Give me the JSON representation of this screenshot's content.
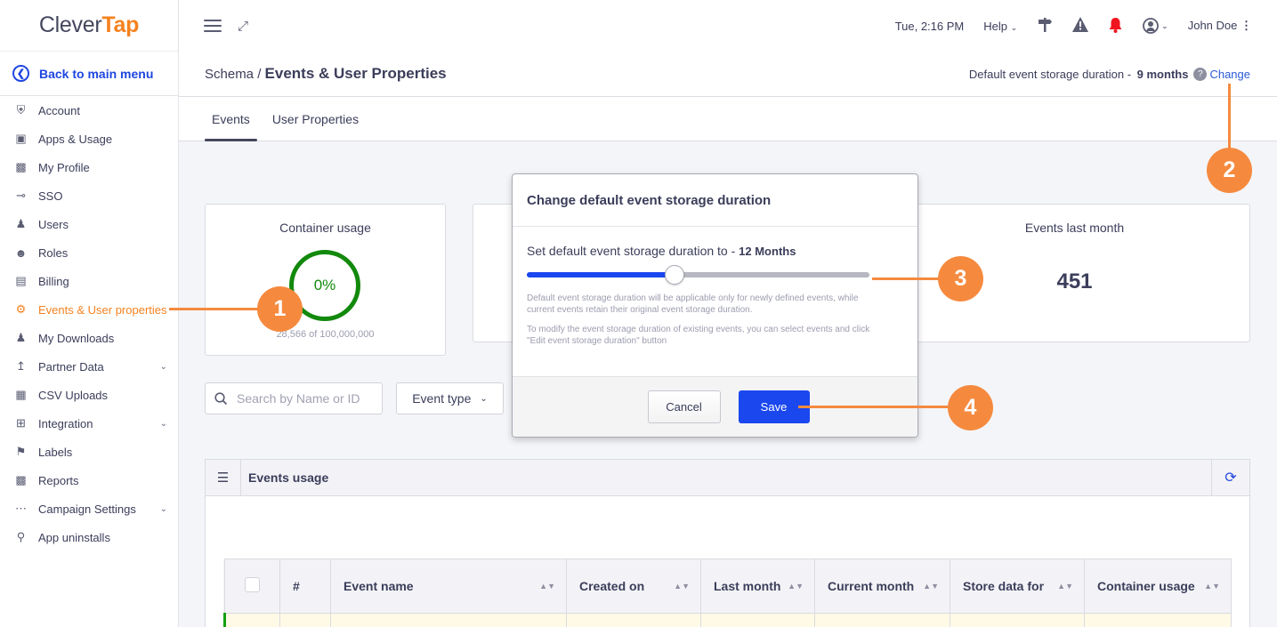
{
  "brand": {
    "part1": "Clever",
    "part2": "Tap"
  },
  "sidebar": {
    "back_label": "Back to main menu",
    "items": [
      {
        "label": "Account",
        "icon": "shield-user-icon"
      },
      {
        "label": "Apps & Usage",
        "icon": "apps-icon"
      },
      {
        "label": "My Profile",
        "icon": "profile-icon"
      },
      {
        "label": "SSO",
        "icon": "key-icon"
      },
      {
        "label": "Users",
        "icon": "users-icon"
      },
      {
        "label": "Roles",
        "icon": "masks-icon"
      },
      {
        "label": "Billing",
        "icon": "credit-card-icon"
      },
      {
        "label": "Events & User properties",
        "icon": "gear-icon",
        "active": true
      },
      {
        "label": "My Downloads",
        "icon": "download-user-icon"
      },
      {
        "label": "Partner Data",
        "icon": "upload-tray-icon",
        "expandable": true
      },
      {
        "label": "CSV Uploads",
        "icon": "csv-icon"
      },
      {
        "label": "Integration",
        "icon": "integration-icon",
        "expandable": true
      },
      {
        "label": "Labels",
        "icon": "tag-icon"
      },
      {
        "label": "Reports",
        "icon": "report-icon"
      },
      {
        "label": "Campaign Settings",
        "icon": "sliders-icon",
        "expandable": true
      },
      {
        "label": "App uninstalls",
        "icon": "uninstall-icon"
      }
    ]
  },
  "topbar": {
    "datetime": "Tue, 2:16 PM",
    "help_label": "Help",
    "user_name": "John Doe"
  },
  "header": {
    "breadcrumb_parent": "Schema",
    "breadcrumb_sep": "/",
    "page_title": "Events & User Properties",
    "storage_prefix": "Default event storage duration - ",
    "storage_value": "9 months",
    "change_label": "Change"
  },
  "tabs": [
    {
      "label": "Events",
      "active": true
    },
    {
      "label": "User Properties",
      "active": false
    }
  ],
  "cards": {
    "container_usage": {
      "title": "Container usage",
      "percent_label": "0%",
      "detail": "28,566 of 100,000,000"
    },
    "events_last_month": {
      "title": "Events last month",
      "value": "451"
    }
  },
  "filters": {
    "search_placeholder": "Search by Name or ID",
    "search_value": "",
    "event_type_label": "Event type"
  },
  "events_panel": {
    "title": "Events usage",
    "columns": [
      "#",
      "Event name",
      "Created on",
      "Last month",
      "Current month",
      "Store data for",
      "Container usage"
    ]
  },
  "modal": {
    "title": "Change default event storage duration",
    "label_prefix": "Set default event storage duration to - ",
    "label_value": "12 Months",
    "slider_fraction": 0.43,
    "note1": "Default event storage duration will be applicable only for newly defined events, while current events retain their original event storage duration.",
    "note2": "To modify the event storage duration of existing events, you can select events and click \"Edit event storage duration\" button",
    "cancel_label": "Cancel",
    "save_label": "Save"
  },
  "callouts": [
    "1",
    "2",
    "3",
    "4"
  ],
  "colors": {
    "accent": "#f5821f",
    "primary": "#1a47ee",
    "success": "#12890c",
    "callout": "#f58a3f"
  }
}
